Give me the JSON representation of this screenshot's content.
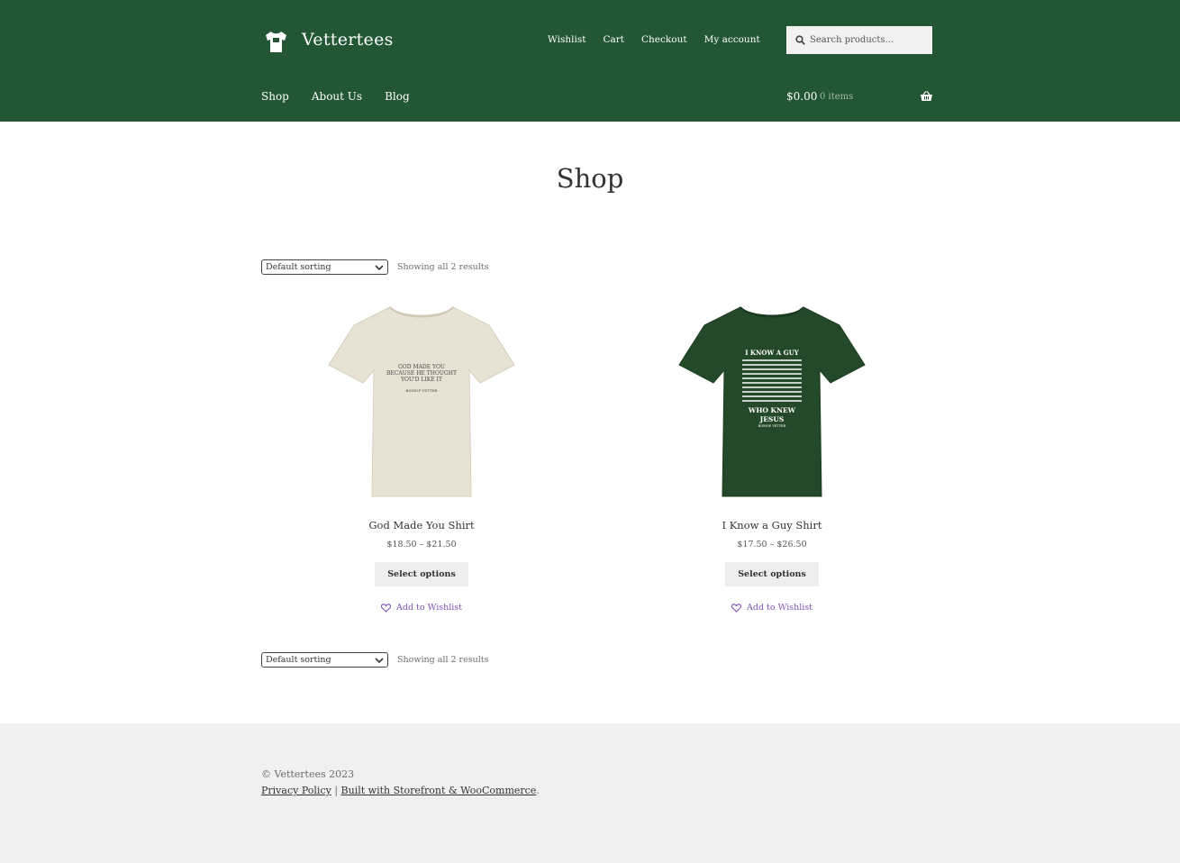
{
  "site": {
    "title": "Vettertees"
  },
  "top_nav": [
    "Wishlist",
    "Cart",
    "Checkout",
    "My account"
  ],
  "search": {
    "placeholder": "Search products…"
  },
  "main_nav": [
    "Shop",
    "About Us",
    "Blog"
  ],
  "cart": {
    "amount": "$0.00",
    "count": "0 items"
  },
  "page": {
    "title": "Shop"
  },
  "toolbar": {
    "sort_label": "Default sorting",
    "results": "Showing all 2 results"
  },
  "products": [
    {
      "name": "God Made You Shirt",
      "price": "$18.50 – $21.50",
      "button": "Select options",
      "wishlist": "Add to Wishlist",
      "shirt_color": "#e8e2d5",
      "print_lines": [
        "GOD MADE YOU",
        "BECAUSE HE THOUGHT",
        "YOU'D LIKE IT",
        "BISHOP VETTER"
      ]
    },
    {
      "name": "I Know a Guy Shirt",
      "price": "$17.50 – $26.50",
      "button": "Select options",
      "wishlist": "Add to Wishlist",
      "shirt_color": "#24492a",
      "print_lines": [
        "I KNOW A GUY",
        "WHO KNEW",
        "JESUS",
        "BISHOP VETTER"
      ]
    }
  ],
  "footer": {
    "copyright": "© Vettertees 2023",
    "privacy": "Privacy Policy",
    "separator": "|",
    "built": "Built with Storefront & WooCommerce",
    "period": "."
  },
  "colors": {
    "header_bg": "#225634",
    "wishlist": "#7f54b3",
    "footer_bg": "#f0f0f0"
  }
}
